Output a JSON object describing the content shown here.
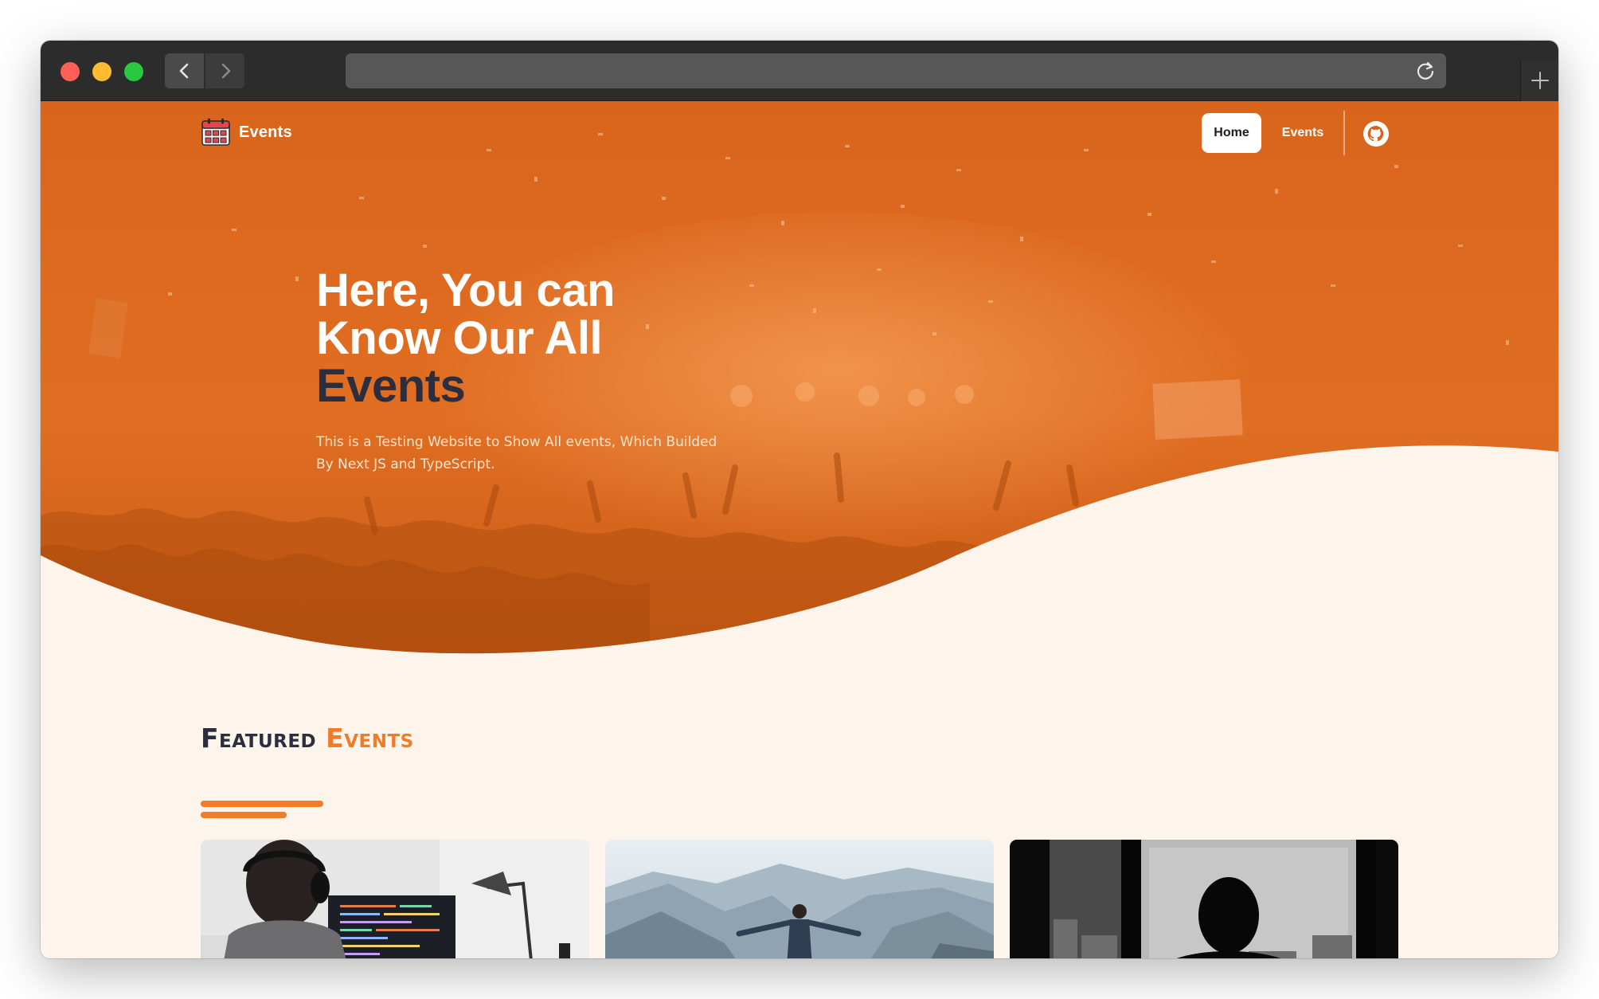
{
  "browser": {
    "back_icon": "chevron-left-icon",
    "forward_icon": "chevron-right-icon",
    "reload_icon": "reload-icon",
    "new_tab_icon": "plus-icon",
    "address_value": ""
  },
  "navbar": {
    "brand_icon": "calendar-icon",
    "brand_label": "Events",
    "links": [
      {
        "label": "Home",
        "active": true
      },
      {
        "label": "Events",
        "active": false
      }
    ],
    "github_icon": "github-icon"
  },
  "hero": {
    "title_line1": "Here, You can",
    "title_line2": "Know Our All",
    "title_highlight": "Events",
    "subtitle": "This is a Testing Website to Show All events, Which Builded By Next JS and TypeScript."
  },
  "featured": {
    "heading_word1": "Featured",
    "heading_word2": "Events",
    "cards": [
      {
        "image": "person-coding-at-desk-photo"
      },
      {
        "image": "man-on-mountain-cliff-photo"
      },
      {
        "image": "silhouette-at-window-photo"
      }
    ]
  },
  "colors": {
    "accent": "#f07b28",
    "hero_overlay": "#d8641c",
    "dark_text": "#2a2e3f",
    "page_background": "#fdf5ec"
  }
}
